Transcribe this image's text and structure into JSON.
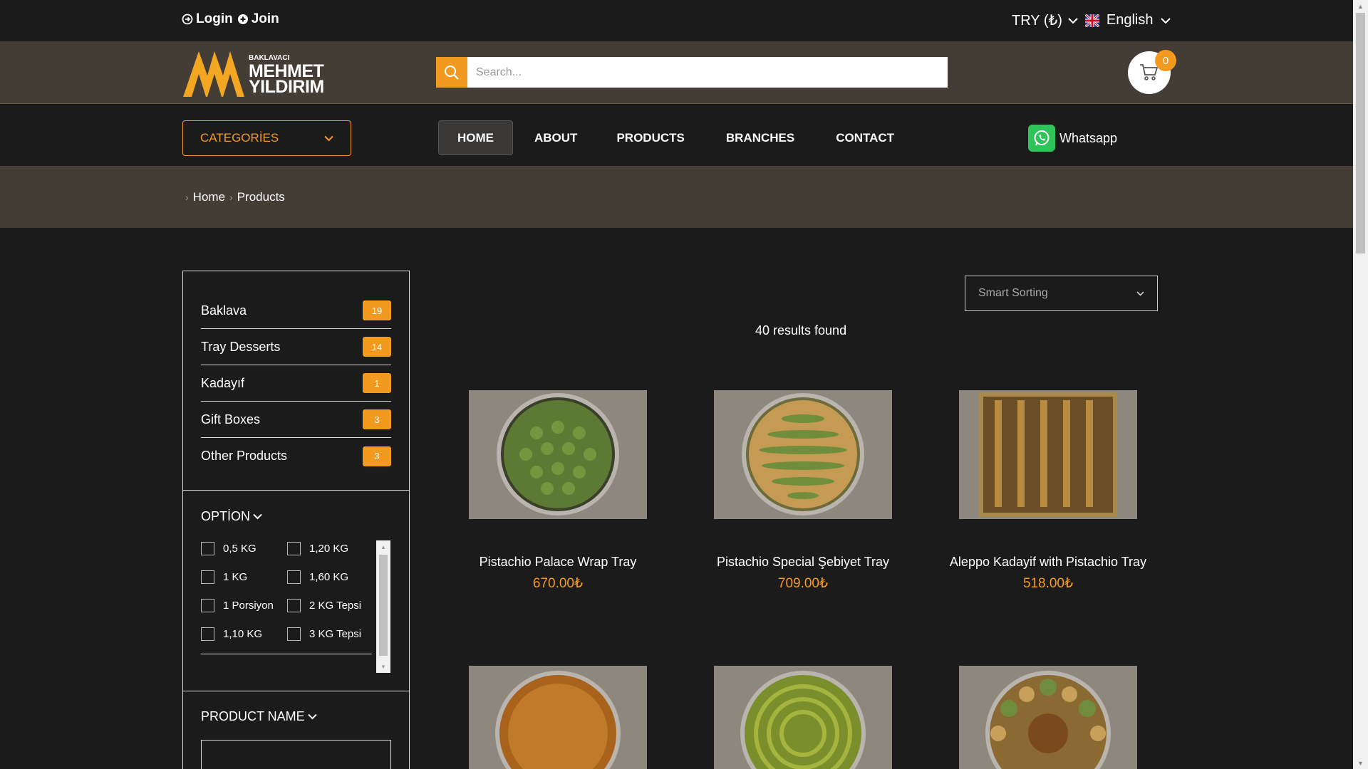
{
  "topbar": {
    "login_label": "Login",
    "join_label": "Join",
    "currency_label": "TRY (₺)",
    "language_label": "English"
  },
  "header": {
    "logo_small": "BAKLAVACI",
    "logo_line1": "MEHMET",
    "logo_line2": "YILDIRIM",
    "search_placeholder": "Search...",
    "cart_count": "0"
  },
  "nav": {
    "categories_label": "CATEGORİES",
    "items": [
      "HOME",
      "ABOUT",
      "PRODUCTS",
      "BRANCHES",
      "CONTACT"
    ],
    "active_item": "HOME",
    "whatsapp_label": "Whatsapp"
  },
  "breadcrumb": [
    "Home",
    "Products"
  ],
  "sidebar": {
    "categories": [
      {
        "name": "Baklava",
        "count": "19"
      },
      {
        "name": "Tray Desserts",
        "count": "14"
      },
      {
        "name": "Kadayıf",
        "count": "1"
      },
      {
        "name": "Gift Boxes",
        "count": "3"
      },
      {
        "name": "Other Products",
        "count": "3"
      }
    ],
    "option_title": "OPTİON",
    "options": [
      "0,5 KG",
      "1,20 KG",
      "1 KG",
      "1,60 KG",
      "1 Porsiyon",
      "2 KG Tepsi",
      "1,10 KG",
      "3 KG Tepsi"
    ],
    "product_name_title": "PRODUCT NAME"
  },
  "main": {
    "sort_label": "Smart Sorting",
    "results_text": "40 results found",
    "products": [
      {
        "name": "Pistachio Palace Wrap Tray",
        "price": "670.00₺"
      },
      {
        "name": "Pistachio Special Şebiyet Tray",
        "price": "709.00₺"
      },
      {
        "name": "Aleppo Kadayif with Pistachio Tray",
        "price": "518.00₺"
      },
      {
        "name": "",
        "price": ""
      },
      {
        "name": "",
        "price": ""
      },
      {
        "name": "",
        "price": ""
      }
    ]
  },
  "colors": {
    "accent": "#f19a1f",
    "header_bg": "#433d36",
    "page_bg": "#1b1b1b"
  }
}
